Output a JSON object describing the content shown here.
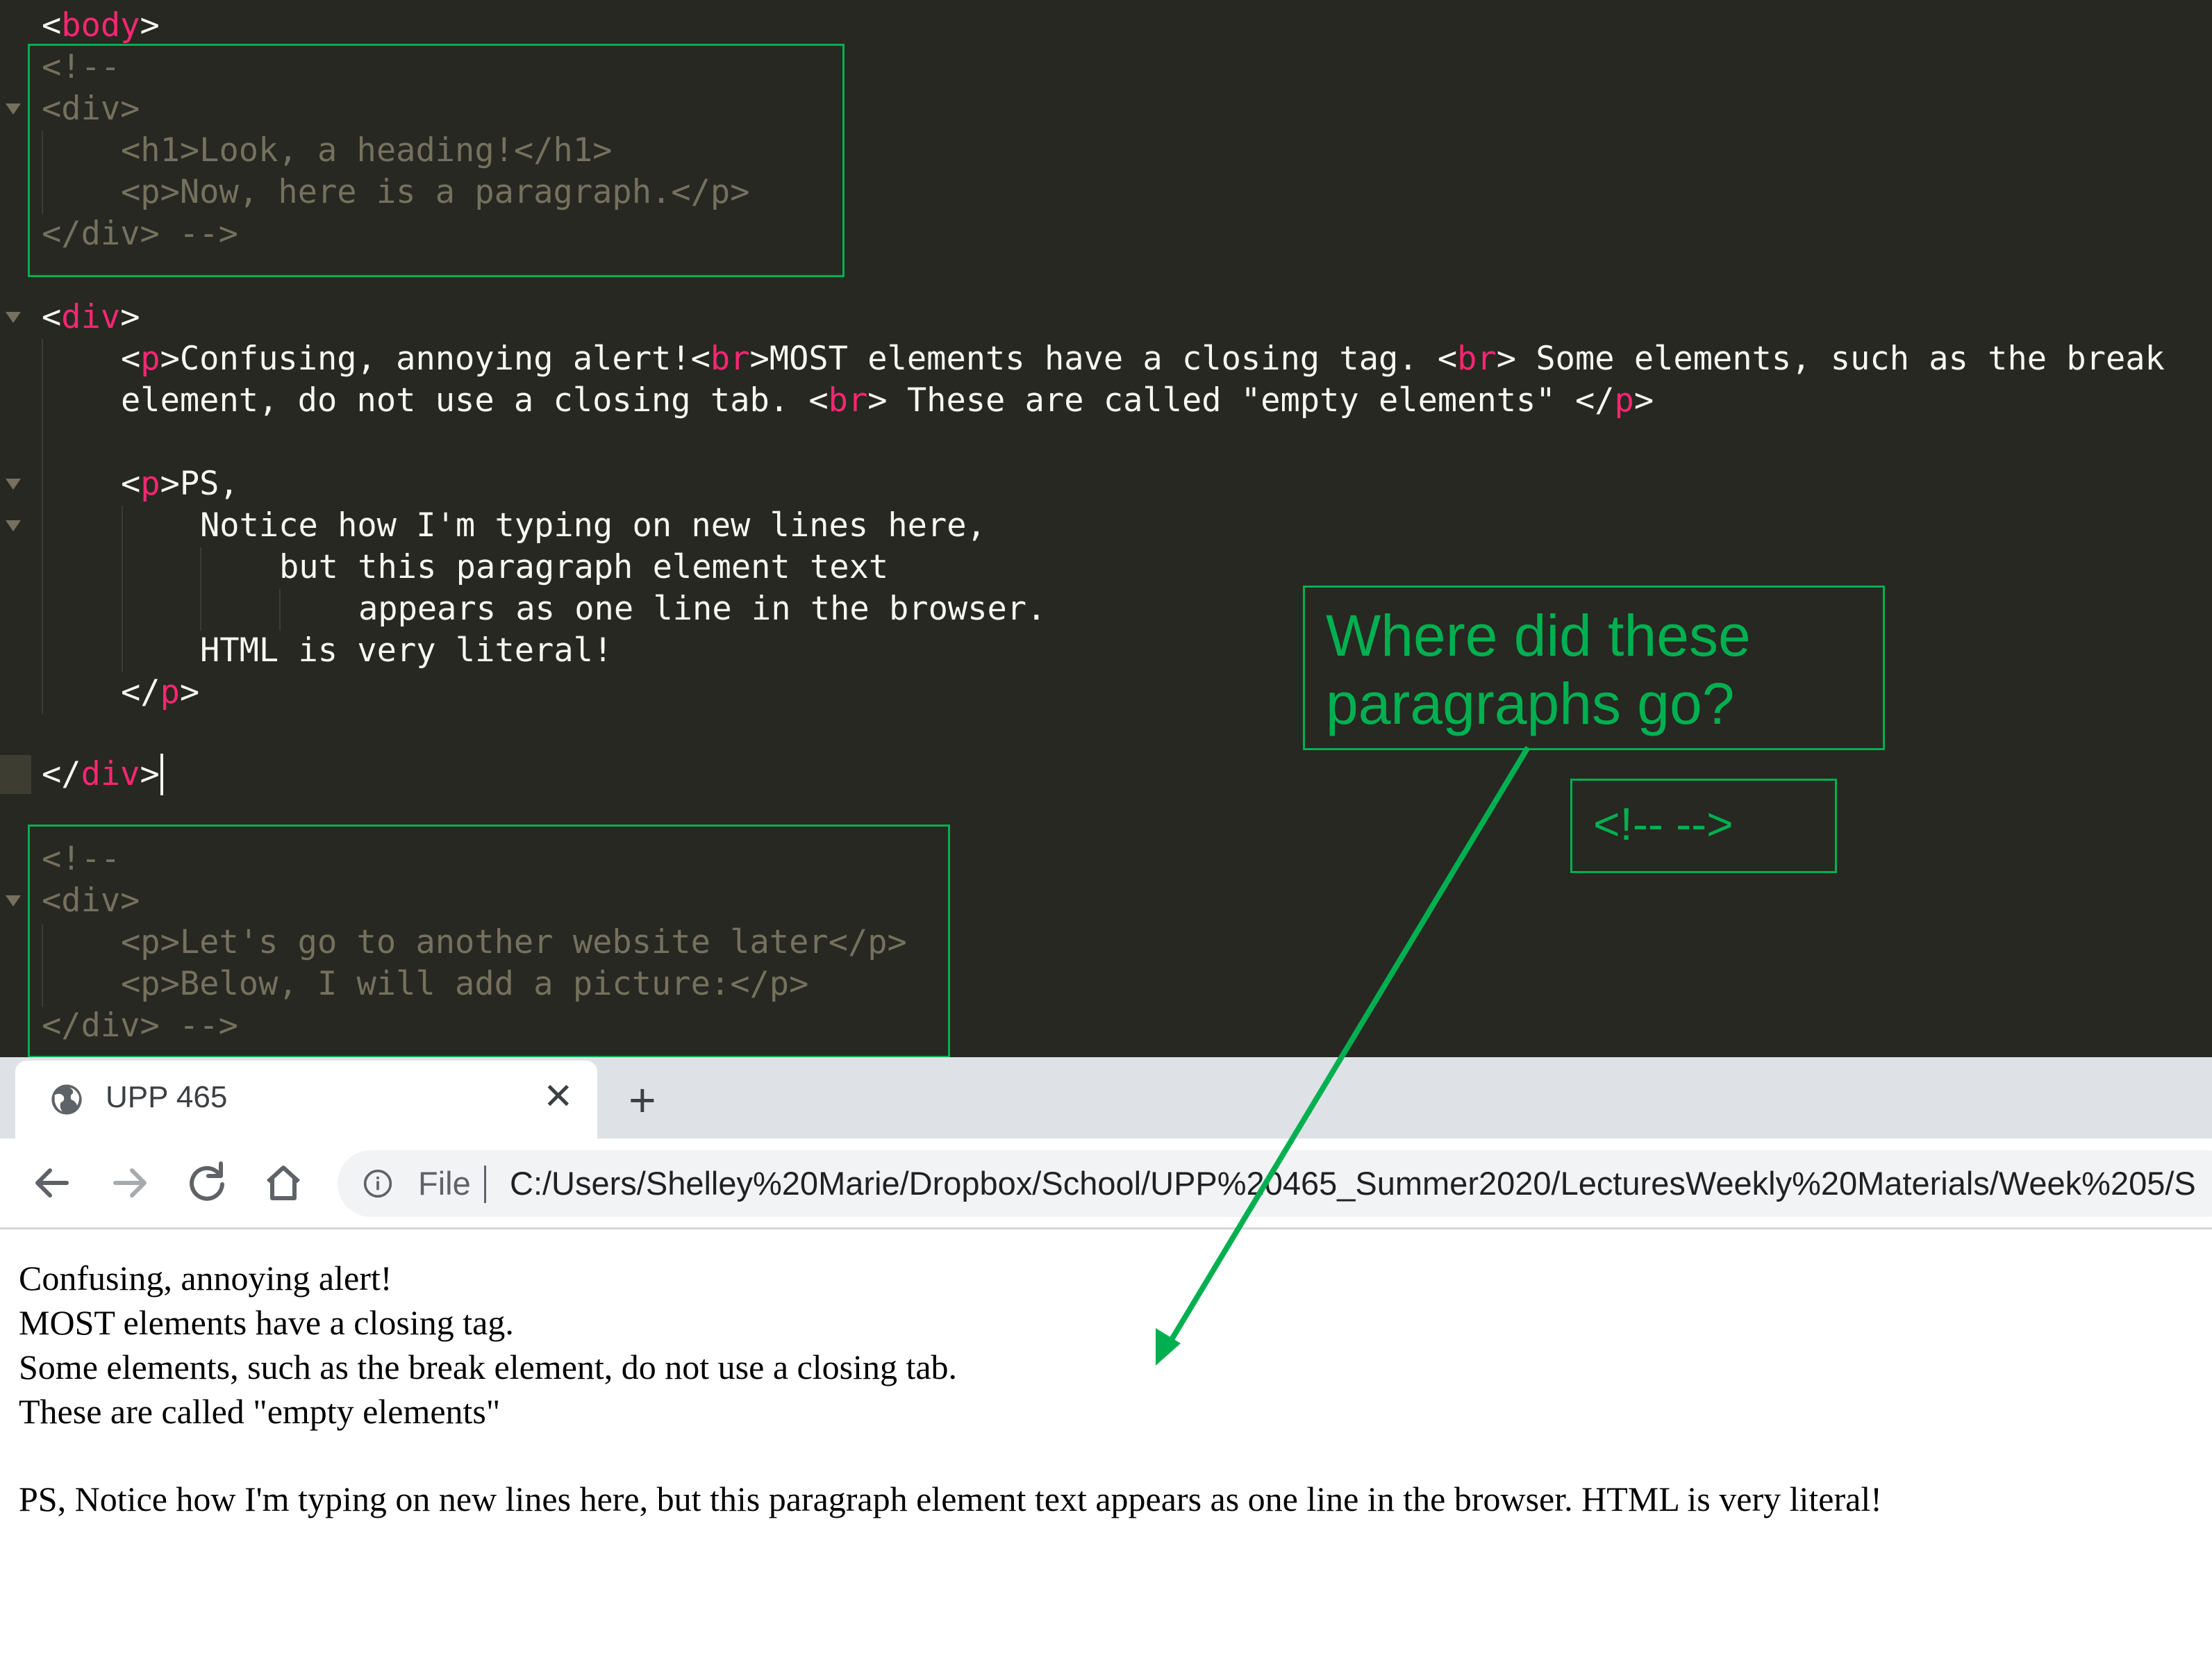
{
  "colors": {
    "tag": "#f92672",
    "comment": "#75715e",
    "text": "#f8f8f2",
    "editor_bg": "#272822",
    "annotation": "#00b050"
  },
  "editor": {
    "lines": {
      "body_tag": "body",
      "comment1": [
        "<!--",
        "<div>",
        "<h1>Look, a heading!</h1>",
        "<p>Now, here is a paragraph.</p>",
        "</div> -->"
      ],
      "div_open": "div",
      "p1_line1": {
        "a": "Confusing, annoying alert!",
        "b": "MOST elements have a closing tag. ",
        "c": " Some elements, such as the break"
      },
      "p1_line2": {
        "a": "element, do not use a closing tab. ",
        "b": " These are called \"empty elements\" "
      },
      "p2_line1": "PS,",
      "p2_line2": "Notice how I'm typing on new lines here,",
      "p2_line3": "but this paragraph element text",
      "p2_line4": "appears as one line in the browser.",
      "p2_line5": "HTML is very literal!",
      "p_tag": "p",
      "br_tag": "br",
      "div_close": "div",
      "comment2": [
        "<!--",
        "<div>",
        "<p>Let's go to another website later</p>",
        "<p>Below, I will add a picture:</p>",
        "</div> -->"
      ]
    }
  },
  "annotations": {
    "question_line1": "Where did these",
    "question_line2": "paragraphs go?",
    "comment_syntax": "<!--  -->"
  },
  "browser": {
    "tab_title": "UPP 465",
    "tab_close": "✕",
    "new_tab": "+",
    "icons": [
      "globe-icon",
      "close-icon",
      "plus-icon",
      "back-arrow-icon",
      "forward-arrow-icon",
      "reload-icon",
      "home-icon",
      "info-icon"
    ],
    "file_label": "File",
    "url": "C:/Users/Shelley%20Marie/Dropbox/School/UPP%20465_Summer2020/LecturesWeekly%20Materials/Week%205/S"
  },
  "page": {
    "lines": [
      "Confusing, annoying alert!",
      "MOST elements have a closing tag.",
      "Some elements, such as the break element, do not use a closing tab.",
      "These are called \"empty elements\""
    ],
    "ps_paragraph": "PS, Notice how I'm typing on new lines here, but this paragraph element text appears as one line in the browser. HTML is very literal!"
  }
}
